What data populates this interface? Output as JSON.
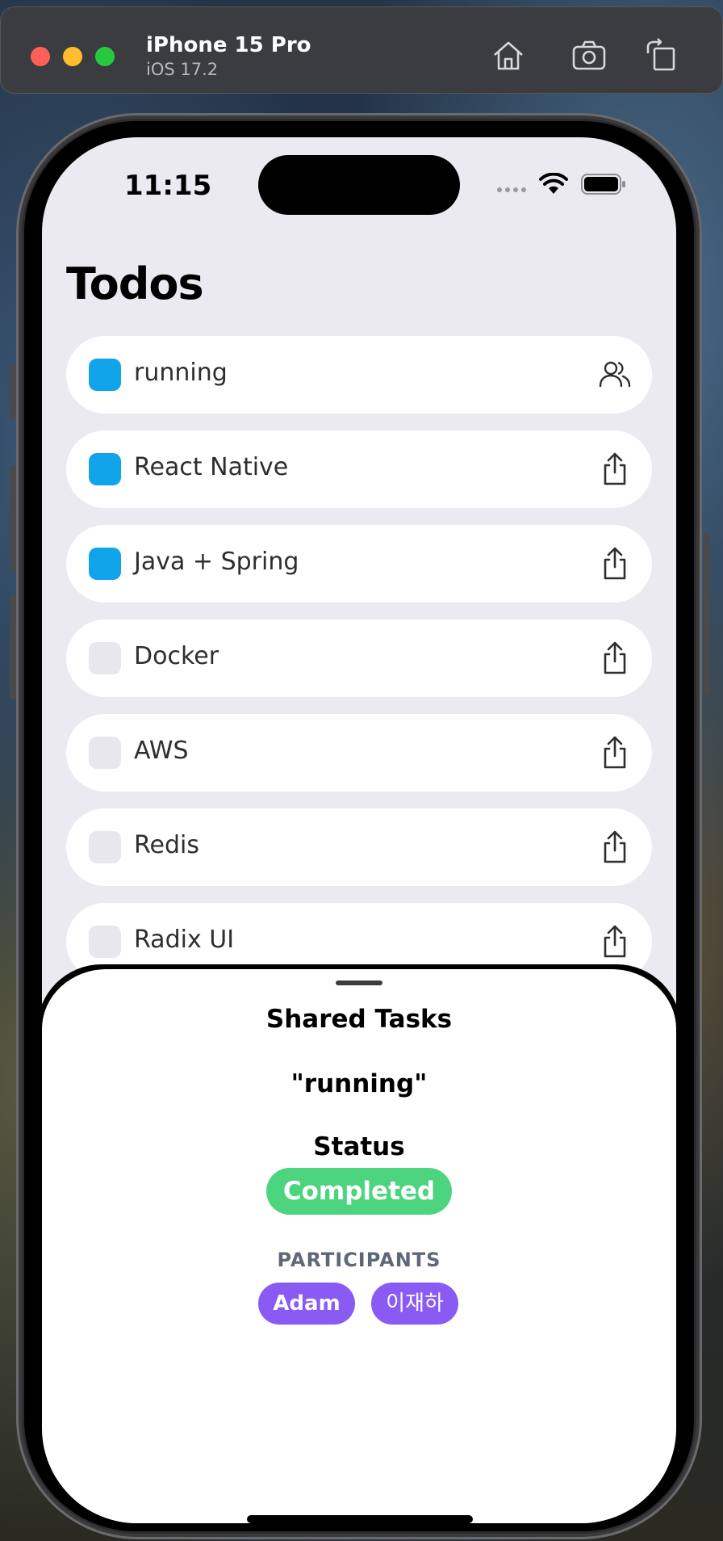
{
  "simulator": {
    "device_name": "iPhone 15 Pro",
    "os_version": "iOS 17.2",
    "toolbar_icons": [
      "home-icon",
      "screenshot-icon",
      "rotate-icon"
    ]
  },
  "status_bar": {
    "time": "11:15",
    "icons": [
      "cellular-signal-icon",
      "wifi-icon",
      "battery-icon"
    ]
  },
  "app": {
    "title": "Todos",
    "todos": [
      {
        "label": "running",
        "checked": true,
        "icon": "participants-icon"
      },
      {
        "label": "React Native",
        "checked": true,
        "icon": "share-icon"
      },
      {
        "label": "Java + Spring",
        "checked": true,
        "icon": "share-icon"
      },
      {
        "label": "Docker",
        "checked": false,
        "icon": "share-icon"
      },
      {
        "label": "AWS",
        "checked": false,
        "icon": "share-icon"
      },
      {
        "label": "Redis",
        "checked": false,
        "icon": "share-icon"
      },
      {
        "label": "Radix UI",
        "checked": false,
        "icon": "share-icon"
      }
    ]
  },
  "sheet": {
    "title": "Shared Tasks",
    "task_name": "\"running\"",
    "status_label": "Status",
    "status_value": "Completed",
    "participants_label": "PARTICIPANTS",
    "participants": [
      "Adam",
      "이재하"
    ]
  },
  "colors": {
    "checked": "#12a4eb",
    "unchecked": "#e8e7ee",
    "status_completed": "#4cd47f",
    "participant_chip": "#8a5af4",
    "screen_bg": "#ebeaf1"
  }
}
